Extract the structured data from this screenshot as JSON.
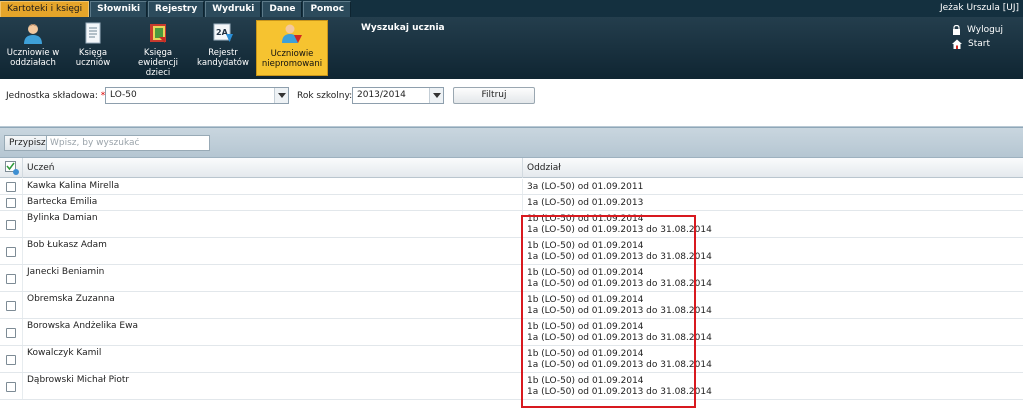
{
  "menu": {
    "tabs": [
      "Kartoteki i księgi",
      "Słowniki",
      "Rejestry",
      "Wydruki",
      "Dane",
      "Pomoc"
    ],
    "user": "Jeżak Urszula [UJ]"
  },
  "toolbar": {
    "title": "Wyszukaj ucznia",
    "tools": [
      {
        "line1": "Uczniowie w",
        "line2": "oddziałach",
        "icon": "student-icon"
      },
      {
        "line1": "Księga",
        "line2": "uczniów",
        "icon": "register-book-icon"
      },
      {
        "line1": "Księga",
        "line2": "ewidencji dzieci",
        "icon": "children-book-icon"
      },
      {
        "line1": "Rejestr",
        "line2": "kandydatów",
        "icon": "candidates-register-icon"
      },
      {
        "line1": "Uczniowie",
        "line2": "niepromowani",
        "icon": "not-promoted-students-icon"
      }
    ],
    "logout": "Wyloguj",
    "start": "Start"
  },
  "filters": {
    "unit_label": "Jednostka składowa:",
    "required_mark": "*",
    "unit_value": "LO-50",
    "year_label": "Rok szkolny:",
    "year_value": "2013/2014",
    "filter_button": "Filtruj"
  },
  "grid": {
    "assign_button": "Przypisz",
    "search_placeholder": "Wpisz, by wyszukać",
    "columns": {
      "student": "Uczeń",
      "unit": "Oddział"
    },
    "rows": [
      {
        "name": "Kawka Kalina Mirella",
        "units": [
          "3a (LO-50) od 01.09.2011"
        ]
      },
      {
        "name": "Bartecka Emilia",
        "units": [
          "1a (LO-50) od 01.09.2013"
        ]
      },
      {
        "name": "Bylinka Damian",
        "units": [
          "1b (LO-50) od 01.09.2014",
          "1a (LO-50) od 01.09.2013 do 31.08.2014"
        ]
      },
      {
        "name": "Bob Łukasz Adam",
        "units": [
          "1b (LO-50) od 01.09.2014",
          "1a (LO-50) od 01.09.2013 do 31.08.2014"
        ]
      },
      {
        "name": "Janecki Beniamin",
        "units": [
          "1b (LO-50) od 01.09.2014",
          "1a (LO-50) od 01.09.2013 do 31.08.2014"
        ]
      },
      {
        "name": "Obremska Zuzanna",
        "units": [
          "1b (LO-50) od 01.09.2014",
          "1a (LO-50) od 01.09.2013 do 31.08.2014"
        ]
      },
      {
        "name": "Borowska Andżelika Ewa",
        "units": [
          "1b (LO-50) od 01.09.2014",
          "1a (LO-50) od 01.09.2013 do 31.08.2014"
        ]
      },
      {
        "name": "Kowalczyk Kamil",
        "units": [
          "1b (LO-50) od 01.09.2014",
          "1a (LO-50) od 01.09.2013 do 31.08.2014"
        ]
      },
      {
        "name": "Dąbrowski Michał Piotr",
        "units": [
          "1b (LO-50) od 01.09.2014",
          "1a (LO-50) od 01.09.2013 do 31.08.2014"
        ]
      }
    ]
  },
  "colors": {
    "menu_bg": "#14303f",
    "active_tab": "#e5a52a",
    "active_tool": "#f6c330",
    "highlight": "#d8191f"
  }
}
